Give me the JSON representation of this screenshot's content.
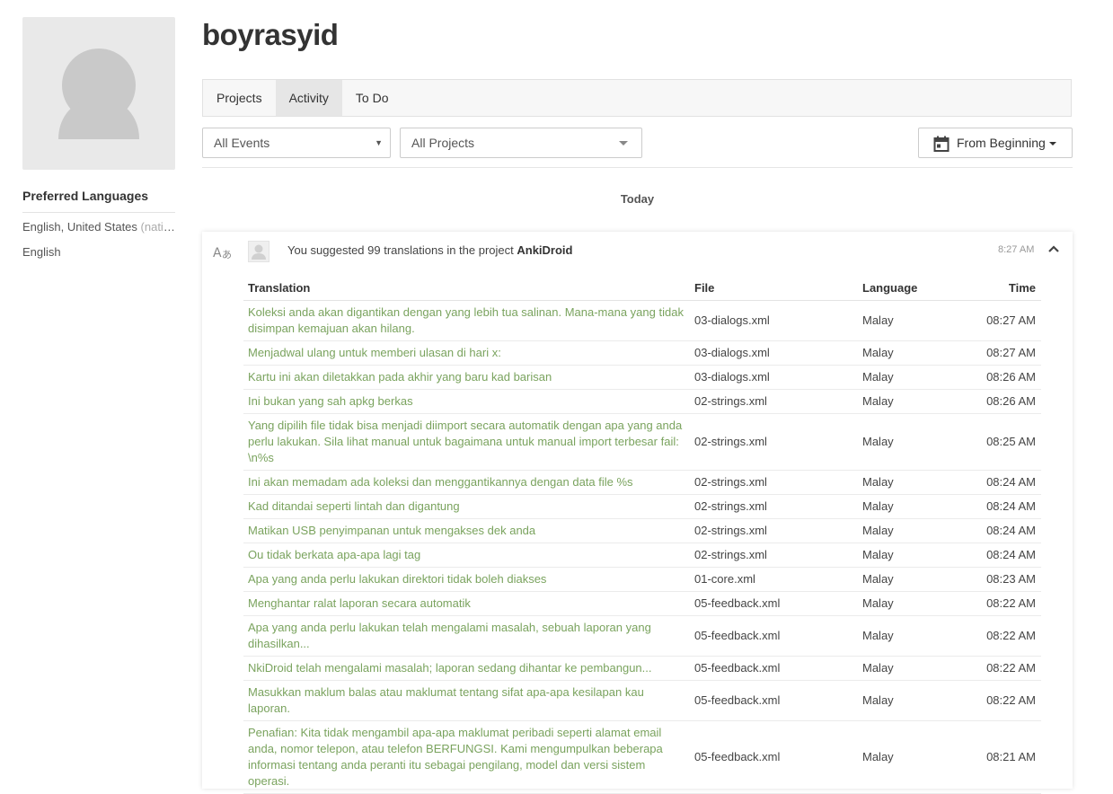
{
  "profile": {
    "username": "boyrasyid",
    "preferred_languages_title": "Preferred Languages",
    "languages": [
      {
        "name": "English, United States",
        "note": "(native)"
      },
      {
        "name": "English",
        "note": ""
      }
    ]
  },
  "tabs": [
    {
      "label": "Projects",
      "active": false
    },
    {
      "label": "Activity",
      "active": true
    },
    {
      "label": "To Do",
      "active": false
    }
  ],
  "filters": {
    "events": "All Events",
    "projects": "All Projects",
    "date": "From Beginning"
  },
  "day_label": "Today",
  "event": {
    "text_prefix": "You suggested 99 translations in the project ",
    "project": "AnkiDroid",
    "time": "8:27 AM",
    "columns": {
      "translation": "Translation",
      "file": "File",
      "language": "Language",
      "time": "Time"
    },
    "rows": [
      {
        "translation": "Koleksi anda akan digantikan dengan yang lebih tua salinan. Mana-mana yang tidak disimpan kemajuan akan hilang.",
        "file": "03-dialogs.xml",
        "language": "Malay",
        "time": "08:27 AM"
      },
      {
        "translation": "Menjadwal ulang untuk memberi ulasan di hari x:",
        "file": "03-dialogs.xml",
        "language": "Malay",
        "time": "08:27 AM"
      },
      {
        "translation": "Kartu ini akan diletakkan pada akhir yang baru kad barisan",
        "file": "03-dialogs.xml",
        "language": "Malay",
        "time": "08:26 AM"
      },
      {
        "translation": "Ini bukan yang sah apkg berkas",
        "file": "02-strings.xml",
        "language": "Malay",
        "time": "08:26 AM"
      },
      {
        "translation": "Yang dipilih file tidak bisa menjadi diimport secara automatik dengan apa yang anda perlu lakukan. Sila lihat manual untuk bagaimana untuk manual import terbesar fail: \\n%s",
        "file": "02-strings.xml",
        "language": "Malay",
        "time": "08:25 AM"
      },
      {
        "translation": "Ini akan memadam ada koleksi dan menggantikannya dengan data file %s",
        "file": "02-strings.xml",
        "language": "Malay",
        "time": "08:24 AM"
      },
      {
        "translation": "Kad ditandai seperti lintah dan digantung",
        "file": "02-strings.xml",
        "language": "Malay",
        "time": "08:24 AM"
      },
      {
        "translation": "Matikan USB penyimpanan untuk mengakses dek anda",
        "file": "02-strings.xml",
        "language": "Malay",
        "time": "08:24 AM"
      },
      {
        "translation": "Ou tidak berkata apa-apa lagi tag",
        "file": "02-strings.xml",
        "language": "Malay",
        "time": "08:24 AM"
      },
      {
        "translation": "Apa yang anda perlu lakukan direktori tidak boleh diakses",
        "file": "01-core.xml",
        "language": "Malay",
        "time": "08:23 AM"
      },
      {
        "translation": "Menghantar ralat laporan secara automatik",
        "file": "05-feedback.xml",
        "language": "Malay",
        "time": "08:22 AM"
      },
      {
        "translation": "Apa yang anda perlu lakukan telah mengalami masalah, sebuah laporan yang dihasilkan...",
        "file": "05-feedback.xml",
        "language": "Malay",
        "time": "08:22 AM"
      },
      {
        "translation": "NkiDroid telah mengalami masalah; laporan sedang dihantar ke pembangun...",
        "file": "05-feedback.xml",
        "language": "Malay",
        "time": "08:22 AM",
        "clip": true
      },
      {
        "translation": "Masukkan maklum balas atau maklumat tentang sifat apa-apa kesilapan kau laporan.",
        "file": "05-feedback.xml",
        "language": "Malay",
        "time": "08:22 AM"
      },
      {
        "translation": "Penafian: Kita tidak mengambil apa-apa maklumat peribadi seperti alamat email anda, nomor telepon, atau telefon BERFUNGSI. Kami mengumpulkan beberapa informasi tentang anda peranti itu sebagai pengilang, model dan versi sistem operasi.",
        "file": "05-feedback.xml",
        "language": "Malay",
        "time": "08:21 AM"
      }
    ]
  }
}
